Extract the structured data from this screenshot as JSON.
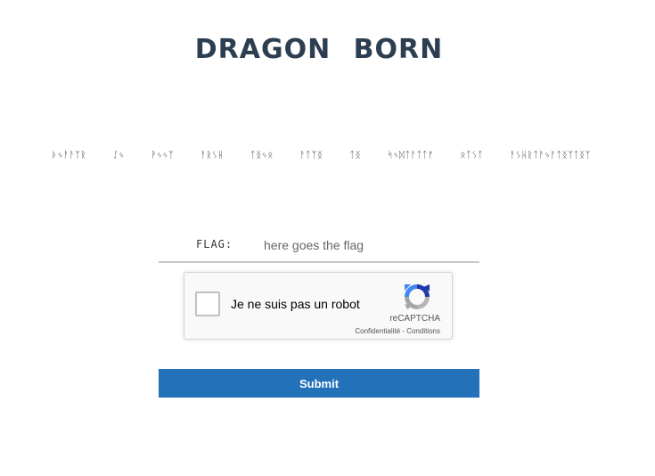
{
  "header": {
    "title": "DRAGON BORN"
  },
  "message": {
    "runes": "ᚦᛃᚨᚨᛉᚱ ᛇᛃ ᚹᛃᛃᛉ ᚨᚱᛊᚺ ᛏᛝᛃᛟ ᚨᛏᛉᛝ ᛏᛝ ᛋᛃᛞᛏᚨᛏᛏᚠ ᛟᛏᛊᛏ ᚨᛊᚺᚱᛏᚨᛃᚨᛏᛝᛉᛏᛝᛉ"
  },
  "form": {
    "flag_label": "FLAG:",
    "flag_placeholder": "here goes the flag",
    "submit_label": "Submit"
  },
  "captcha": {
    "label": "Je ne suis pas un robot",
    "brand": "reCAPTCHA",
    "privacy": "Confidentialité",
    "separator": " - ",
    "terms": "Conditions",
    "checked": false,
    "colors": {
      "blue": "#1c3aa9",
      "light_blue": "#4285f4",
      "gray": "#b6b6b6"
    }
  },
  "colors": {
    "title": "#2c3e50",
    "submit_bg": "#2271b9"
  }
}
